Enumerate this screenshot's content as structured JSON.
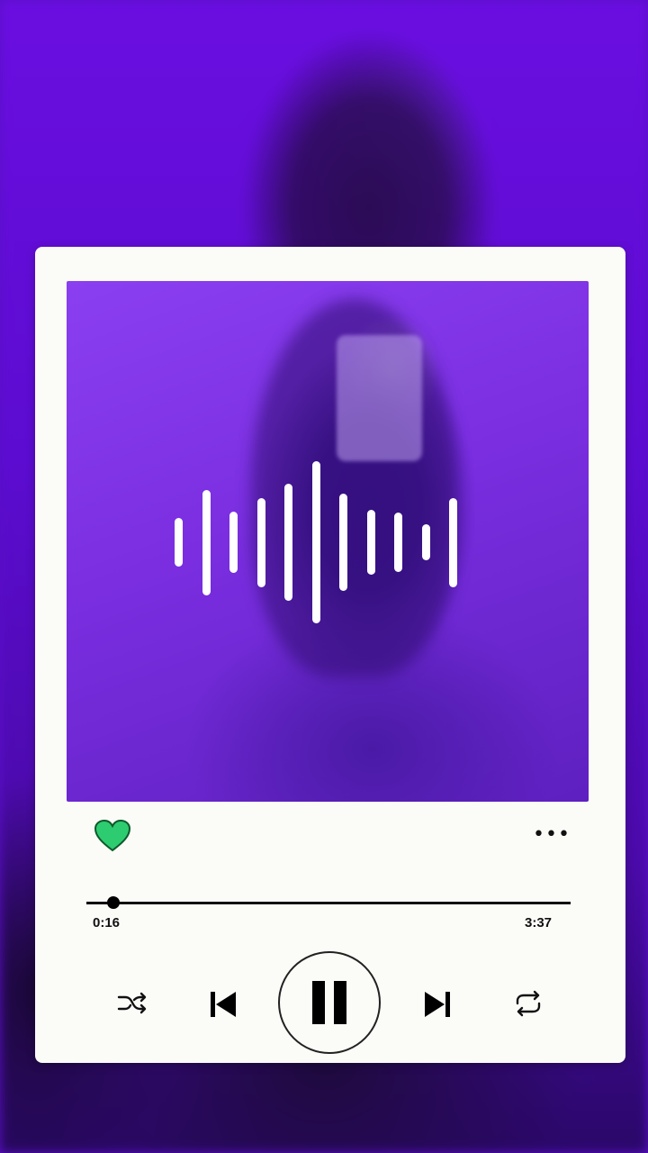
{
  "player": {
    "elapsed": "0:16",
    "total": "3:37",
    "progress_fraction": 0.055,
    "liked": true,
    "more_label": "•••"
  },
  "waveform": {
    "bar_levels": [
      0.3,
      0.65,
      0.38,
      0.55,
      0.72,
      1.0,
      0.6,
      0.4,
      0.37,
      0.22,
      0.55
    ]
  },
  "colors": {
    "accent_like": "#2ecc71",
    "card_bg": "#fbfbf8",
    "background": "#5a0fc8"
  },
  "icons": {
    "like": "heart-icon",
    "more": "more-options-icon",
    "shuffle": "shuffle-icon",
    "previous": "skip-previous-icon",
    "pause": "pause-icon",
    "next": "skip-next-icon",
    "repeat": "repeat-icon"
  }
}
